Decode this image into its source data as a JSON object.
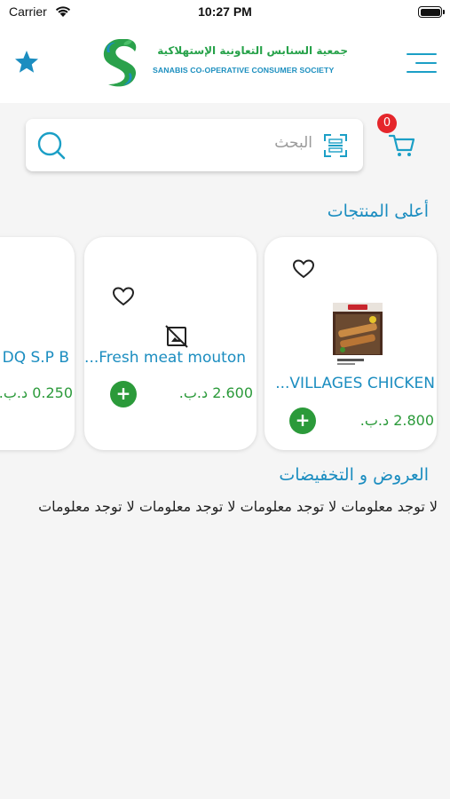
{
  "status_bar": {
    "carrier": "Carrier",
    "time": "10:27 PM"
  },
  "header": {
    "logo_ar": "جمعية السنابس التعاونية الإستهلاكية",
    "logo_en": "SANABIS CO-OPERATIVE CONSUMER SOCIETY",
    "icons": {
      "favorites": "star-icon",
      "menu": "menu-icon"
    }
  },
  "search": {
    "placeholder": "البحث",
    "scan_icon": "barcode-scan-icon"
  },
  "cart": {
    "count": "0"
  },
  "sections": {
    "top_products": "أعلى المنتجات",
    "offers": "العروض و التخفيضات"
  },
  "products": [
    {
      "name": "...VILLAGES CHICKEN",
      "price": "2.800 د.ب.",
      "image": "product-box-photo"
    },
    {
      "name": "...Fresh meat mouton",
      "price": "2.600 د.ب.",
      "image": "image-unavailable-icon"
    },
    {
      "name": "DQ S.P B",
      "price": "0.250 د.ب.",
      "image": ""
    }
  ],
  "offers": {
    "empty_text": "لا توجد معلومات لا توجد معلومات لا توجد معلومات لا توجد معلومات"
  },
  "colors": {
    "primary_blue": "#1b8dc0",
    "green": "#2b9a3a",
    "badge_red": "#e5262b"
  }
}
